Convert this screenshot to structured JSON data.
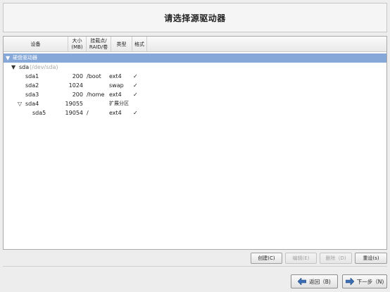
{
  "header": {
    "title": "请选择源驱动器"
  },
  "columns": {
    "device": "设备",
    "size_line1": "大小",
    "size_line2": "(MB)",
    "mount_line1": "挂载点/",
    "mount_line2": "RAID/卷",
    "type": "类型",
    "format": "格式"
  },
  "tree": {
    "group": {
      "label": "硬盘驱动器"
    },
    "disk": {
      "name": "sda",
      "path": "(/dev/sda)"
    },
    "partitions": [
      {
        "device": "sda1",
        "size": "200",
        "mount": "/boot",
        "type": "ext4",
        "format": "✓"
      },
      {
        "device": "sda2",
        "size": "1024",
        "mount": "",
        "type": "swap",
        "format": "✓"
      },
      {
        "device": "sda3",
        "size": "200",
        "mount": "/home",
        "type": "ext4",
        "format": "✓"
      },
      {
        "device": "sda4",
        "size": "19055",
        "mount": "",
        "type": "扩展分区",
        "format": ""
      },
      {
        "device": "sda5",
        "size": "19054",
        "mount": "/",
        "type": "ext4",
        "format": "✓"
      }
    ]
  },
  "actions": {
    "create": "创建(C)",
    "edit": "编辑(E)",
    "delete": "删除（D)",
    "reset": "重设(s)"
  },
  "nav": {
    "back": "返回（B)",
    "next": "下一步（N)"
  },
  "colors": {
    "selection": "#86a8d8",
    "arrow_blue": "#3a6fb5"
  }
}
